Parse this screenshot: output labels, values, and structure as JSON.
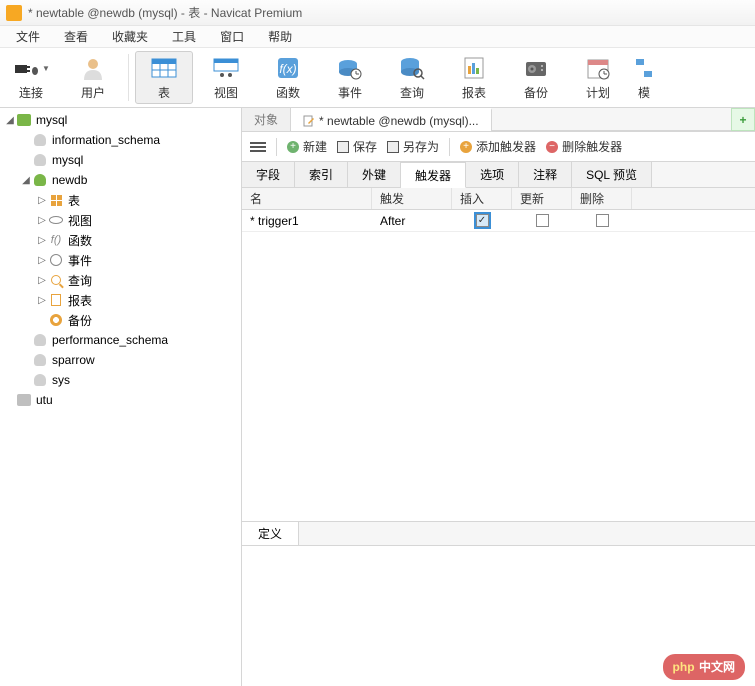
{
  "window": {
    "title": "* newtable @newdb (mysql) - 表 - Navicat Premium"
  },
  "menu": {
    "file": "文件",
    "view": "查看",
    "fav": "收藏夹",
    "tools": "工具",
    "window": "窗口",
    "help": "帮助"
  },
  "toolbar": {
    "connect": "连接",
    "user": "用户",
    "table": "表",
    "view": "视图",
    "func": "函数",
    "event": "事件",
    "query": "查询",
    "report": "报表",
    "backup": "备份",
    "schedule": "计划",
    "model": "模"
  },
  "sidebar": {
    "c0": "mysql",
    "c0_db0": "information_schema",
    "c0_db1": "mysql",
    "c0_db2": "newdb",
    "c0_db2_tables": "表",
    "c0_db2_views": "视图",
    "c0_db2_funcs": "函数",
    "c0_db2_events": "事件",
    "c0_db2_queries": "查询",
    "c0_db2_reports": "报表",
    "c0_db2_backups": "备份",
    "c0_db3": "performance_schema",
    "c0_db4": "sparrow",
    "c0_db5": "sys",
    "c1": "utu"
  },
  "tabs": {
    "obj": "对象",
    "editor": "* newtable @newdb (mysql)..."
  },
  "actions": {
    "new": "新建",
    "save": "保存",
    "saveas": "另存为",
    "add_trigger": "添加触发器",
    "del_trigger": "删除触发器"
  },
  "subtabs": {
    "fields": "字段",
    "indexes": "索引",
    "fk": "外键",
    "triggers": "触发器",
    "options": "选项",
    "comment": "注释",
    "sql": "SQL 预览"
  },
  "grid": {
    "h_name": "名",
    "h_fire": "触发",
    "h_insert": "插入",
    "h_update": "更新",
    "h_delete": "删除",
    "r0_name": "* trigger1",
    "r0_fire": "After"
  },
  "deftab": "定义",
  "watermark": "中文网"
}
